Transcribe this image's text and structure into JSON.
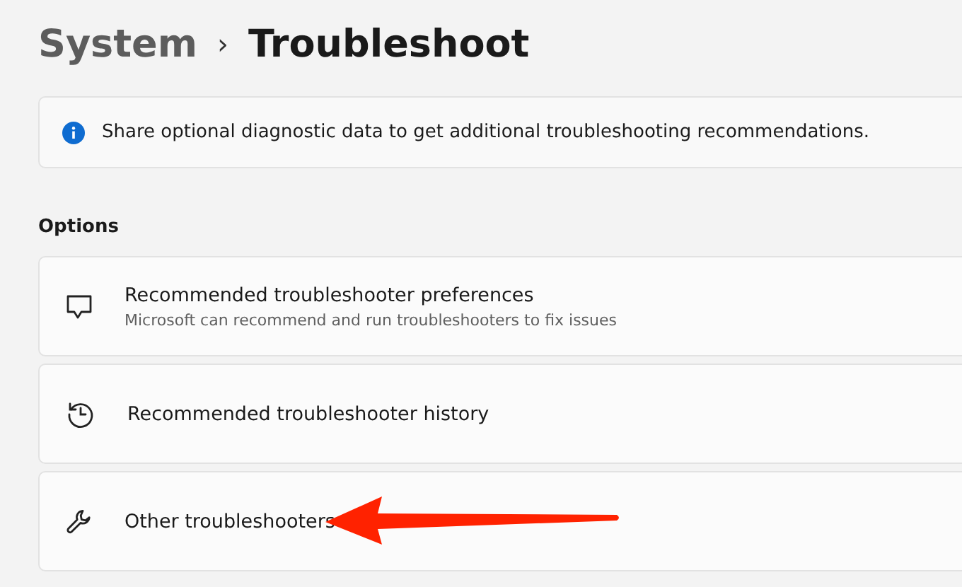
{
  "breadcrumb": {
    "parent": "System",
    "separator": "›",
    "current": "Troubleshoot"
  },
  "info_bar": {
    "text": "Share optional diagnostic data to get additional troubleshooting recommendations."
  },
  "section_title": "Options",
  "items": [
    {
      "kind": "chat",
      "title": "Recommended troubleshooter preferences",
      "subtitle": "Microsoft can recommend and run troubleshooters to fix issues"
    },
    {
      "kind": "history",
      "title": "Recommended troubleshooter history"
    },
    {
      "kind": "wrench",
      "title": "Other troubleshooters"
    }
  ]
}
